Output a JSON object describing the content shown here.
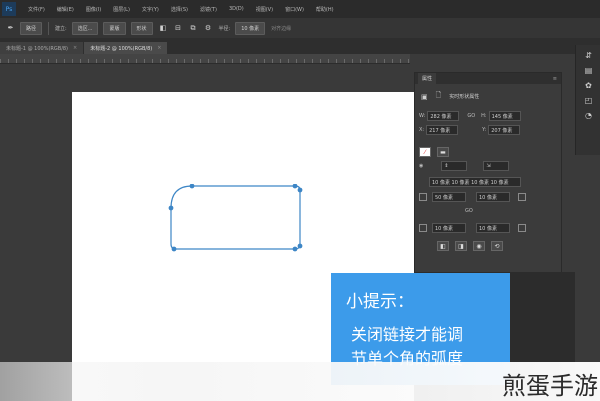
{
  "menubar": {
    "app_icon": "Ps",
    "items": [
      "文件(F)",
      "编辑(E)",
      "图像(I)",
      "图层(L)",
      "文字(Y)",
      "选择(S)",
      "滤镜(T)",
      "3D(D)",
      "视图(V)",
      "窗口(W)",
      "帮助(H)"
    ]
  },
  "options": {
    "path_mode": "路径",
    "build_label": "建立:",
    "buttons": [
      "选区...",
      "蒙版",
      "形状"
    ],
    "corner_label": "半径:",
    "corner_value": "10 像素",
    "align_edges": "对齐边缘"
  },
  "tabs": [
    {
      "label": "未标题-1 @ 100%(RGB/8)",
      "active": false
    },
    {
      "label": "未标题-2 @ 100%(RGB/8)",
      "active": true
    }
  ],
  "panel": {
    "title": "属性",
    "subtitle": "实时形状属性",
    "w_label": "W:",
    "w_value": "282 像素",
    "h_label": "H:",
    "h_value": "145 像素",
    "x_label": "X:",
    "x_value": "217 像素",
    "y_label": "Y:",
    "y_value": "207 像素",
    "corners_summary": "10 像素 10 像素 10 像素 10 像素",
    "corner_tl": "50 像素",
    "corner_tr": "10 像素",
    "corner_bl": "10 像素",
    "corner_br": "10 像素",
    "link_icon": "link-icon"
  },
  "tip": {
    "title": "小提示：",
    "line1": "关闭链接才能调",
    "line2": "节单个角的弧度"
  },
  "watermark": "煎蛋手游",
  "colors": {
    "tip_bg": "#3c9bea",
    "shape_stroke": "#3d86c6",
    "ui_dark": "#3a3a3a"
  }
}
